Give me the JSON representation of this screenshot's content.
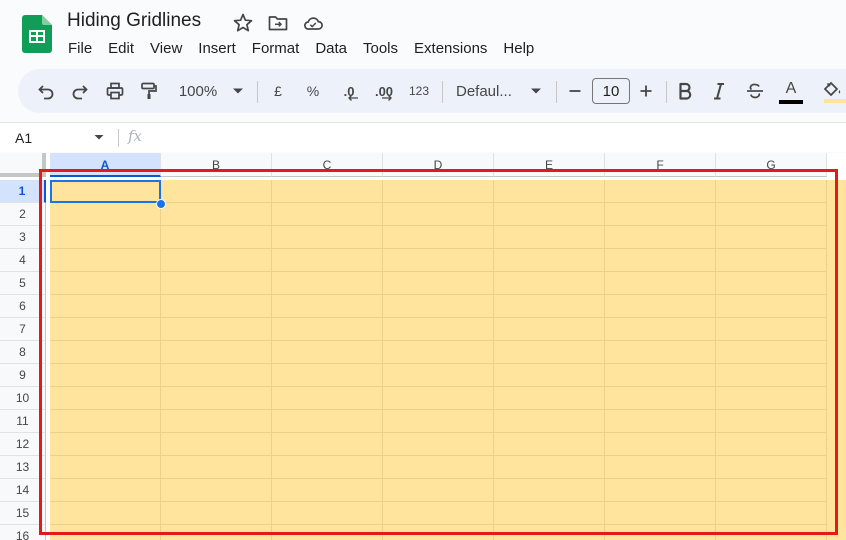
{
  "app": {
    "title": "Hiding Gridlines",
    "menu": [
      "File",
      "Edit",
      "View",
      "Insert",
      "Format",
      "Data",
      "Tools",
      "Extensions",
      "Help"
    ]
  },
  "toolbar": {
    "zoom": "100%",
    "currency": "£",
    "percent": "%",
    "decrease_decimal": ".0",
    "increase_decimal": ".00",
    "more_formats": "123",
    "font": "Defaul...",
    "font_size": "10",
    "text_color_letter": "A",
    "text_color": "#000000"
  },
  "formula_bar": {
    "name_box": "A1",
    "fx": "fx"
  },
  "sheet": {
    "columns": [
      "A",
      "B",
      "C",
      "D",
      "E",
      "F",
      "G"
    ],
    "rows": [
      "1",
      "2",
      "3",
      "4",
      "5",
      "6",
      "7",
      "8",
      "9",
      "10",
      "11",
      "12",
      "13",
      "14",
      "15",
      "16"
    ],
    "selected_cell": "A1",
    "fill_color": "#fee49d",
    "highlight_color": "#e21a1a"
  }
}
